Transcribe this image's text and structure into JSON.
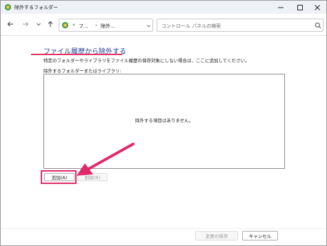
{
  "window": {
    "title": "除外するフォルダー"
  },
  "nav": {
    "address_segments": [
      "フ...",
      "除外..."
    ],
    "address_prefix": "«",
    "search_placeholder": "コントロール パネルの検索"
  },
  "content": {
    "heading": "ファイル履歴から除外する",
    "description": "特定のフォルダーやライブラリをファイル履歴の保存対象にしない場合は、ここに追加してください。",
    "list_label": "除外するフォルダーまたはライブラリ:",
    "empty_message": "除外する項目はありません。",
    "add_button": "追加(A)",
    "remove_button": "削除(R)"
  },
  "footer": {
    "save_button": "変更の保存",
    "cancel_button": "キャンセル"
  },
  "colors": {
    "annotation": "#e0286a",
    "heading": "#1e3c8c"
  },
  "icons": [
    "app-icon",
    "minimize-icon",
    "maximize-icon",
    "close-icon",
    "back-arrow-icon",
    "forward-arrow-icon",
    "chevron-down-icon",
    "up-arrow-icon",
    "control-panel-icon",
    "refresh-icon",
    "search-icon"
  ]
}
